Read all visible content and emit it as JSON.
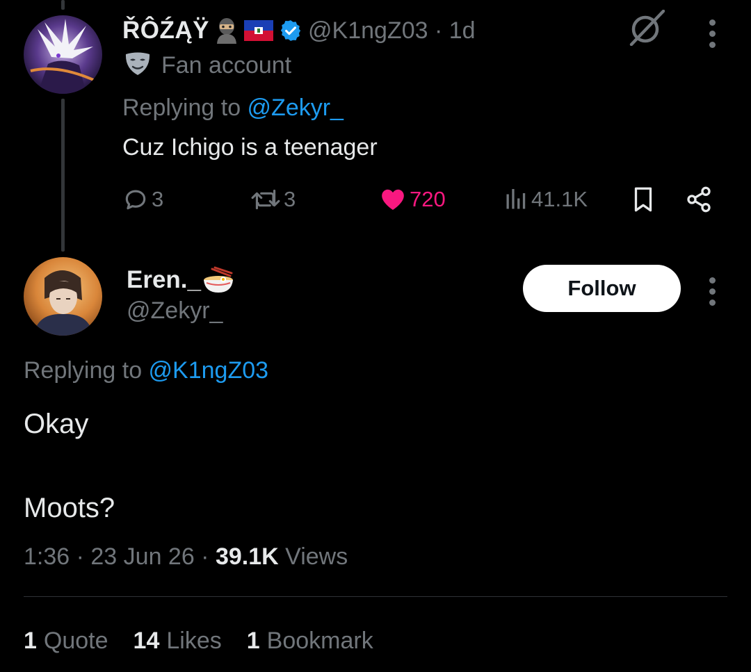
{
  "parent_tweet": {
    "display_name": "ŘÔŹĄŸ",
    "handle_time": "@K1ngZ03 · 1d",
    "fan_label": "Fan account",
    "replying_prefix": "Replying to ",
    "replying_handle": "@Zekyr_",
    "text": "Cuz Ichigo is a teenager",
    "replies": "3",
    "reposts": "3",
    "likes": "720",
    "views": "41.1K",
    "icons": [
      "ninja-emoji-icon",
      "haiti-flag-icon",
      "verified-badge-icon",
      "grok-icon",
      "more-icon",
      "mask-icon",
      "reply-icon",
      "repost-icon",
      "heart-icon",
      "views-icon",
      "bookmark-icon",
      "share-icon"
    ]
  },
  "reply_tweet": {
    "display_name": "Eren._",
    "handle": "@Zekyr_",
    "follow_label": "Follow",
    "replying_prefix": "Replying to ",
    "replying_handle": "@K1ngZ03",
    "line1": "Okay",
    "line2": "Moots?",
    "time": "1:36 · 23 Jun 26 · ",
    "views_count": "39.1K",
    "views_label": " Views",
    "icons": [
      "ramen-emoji-icon",
      "more-icon"
    ]
  },
  "stats": {
    "quotes_count": "1",
    "quotes_label": "Quote",
    "likes_count": "14",
    "likes_label": "Likes",
    "bookmarks_count": "1",
    "bookmarks_label": "Bookmark"
  },
  "colors": {
    "background": "#000000",
    "text_primary": "#e7e9ea",
    "text_secondary": "#71767b",
    "link": "#1d9bf0",
    "like": "#f91880",
    "verified": "#1d9bf0",
    "divider": "#2f3336"
  }
}
